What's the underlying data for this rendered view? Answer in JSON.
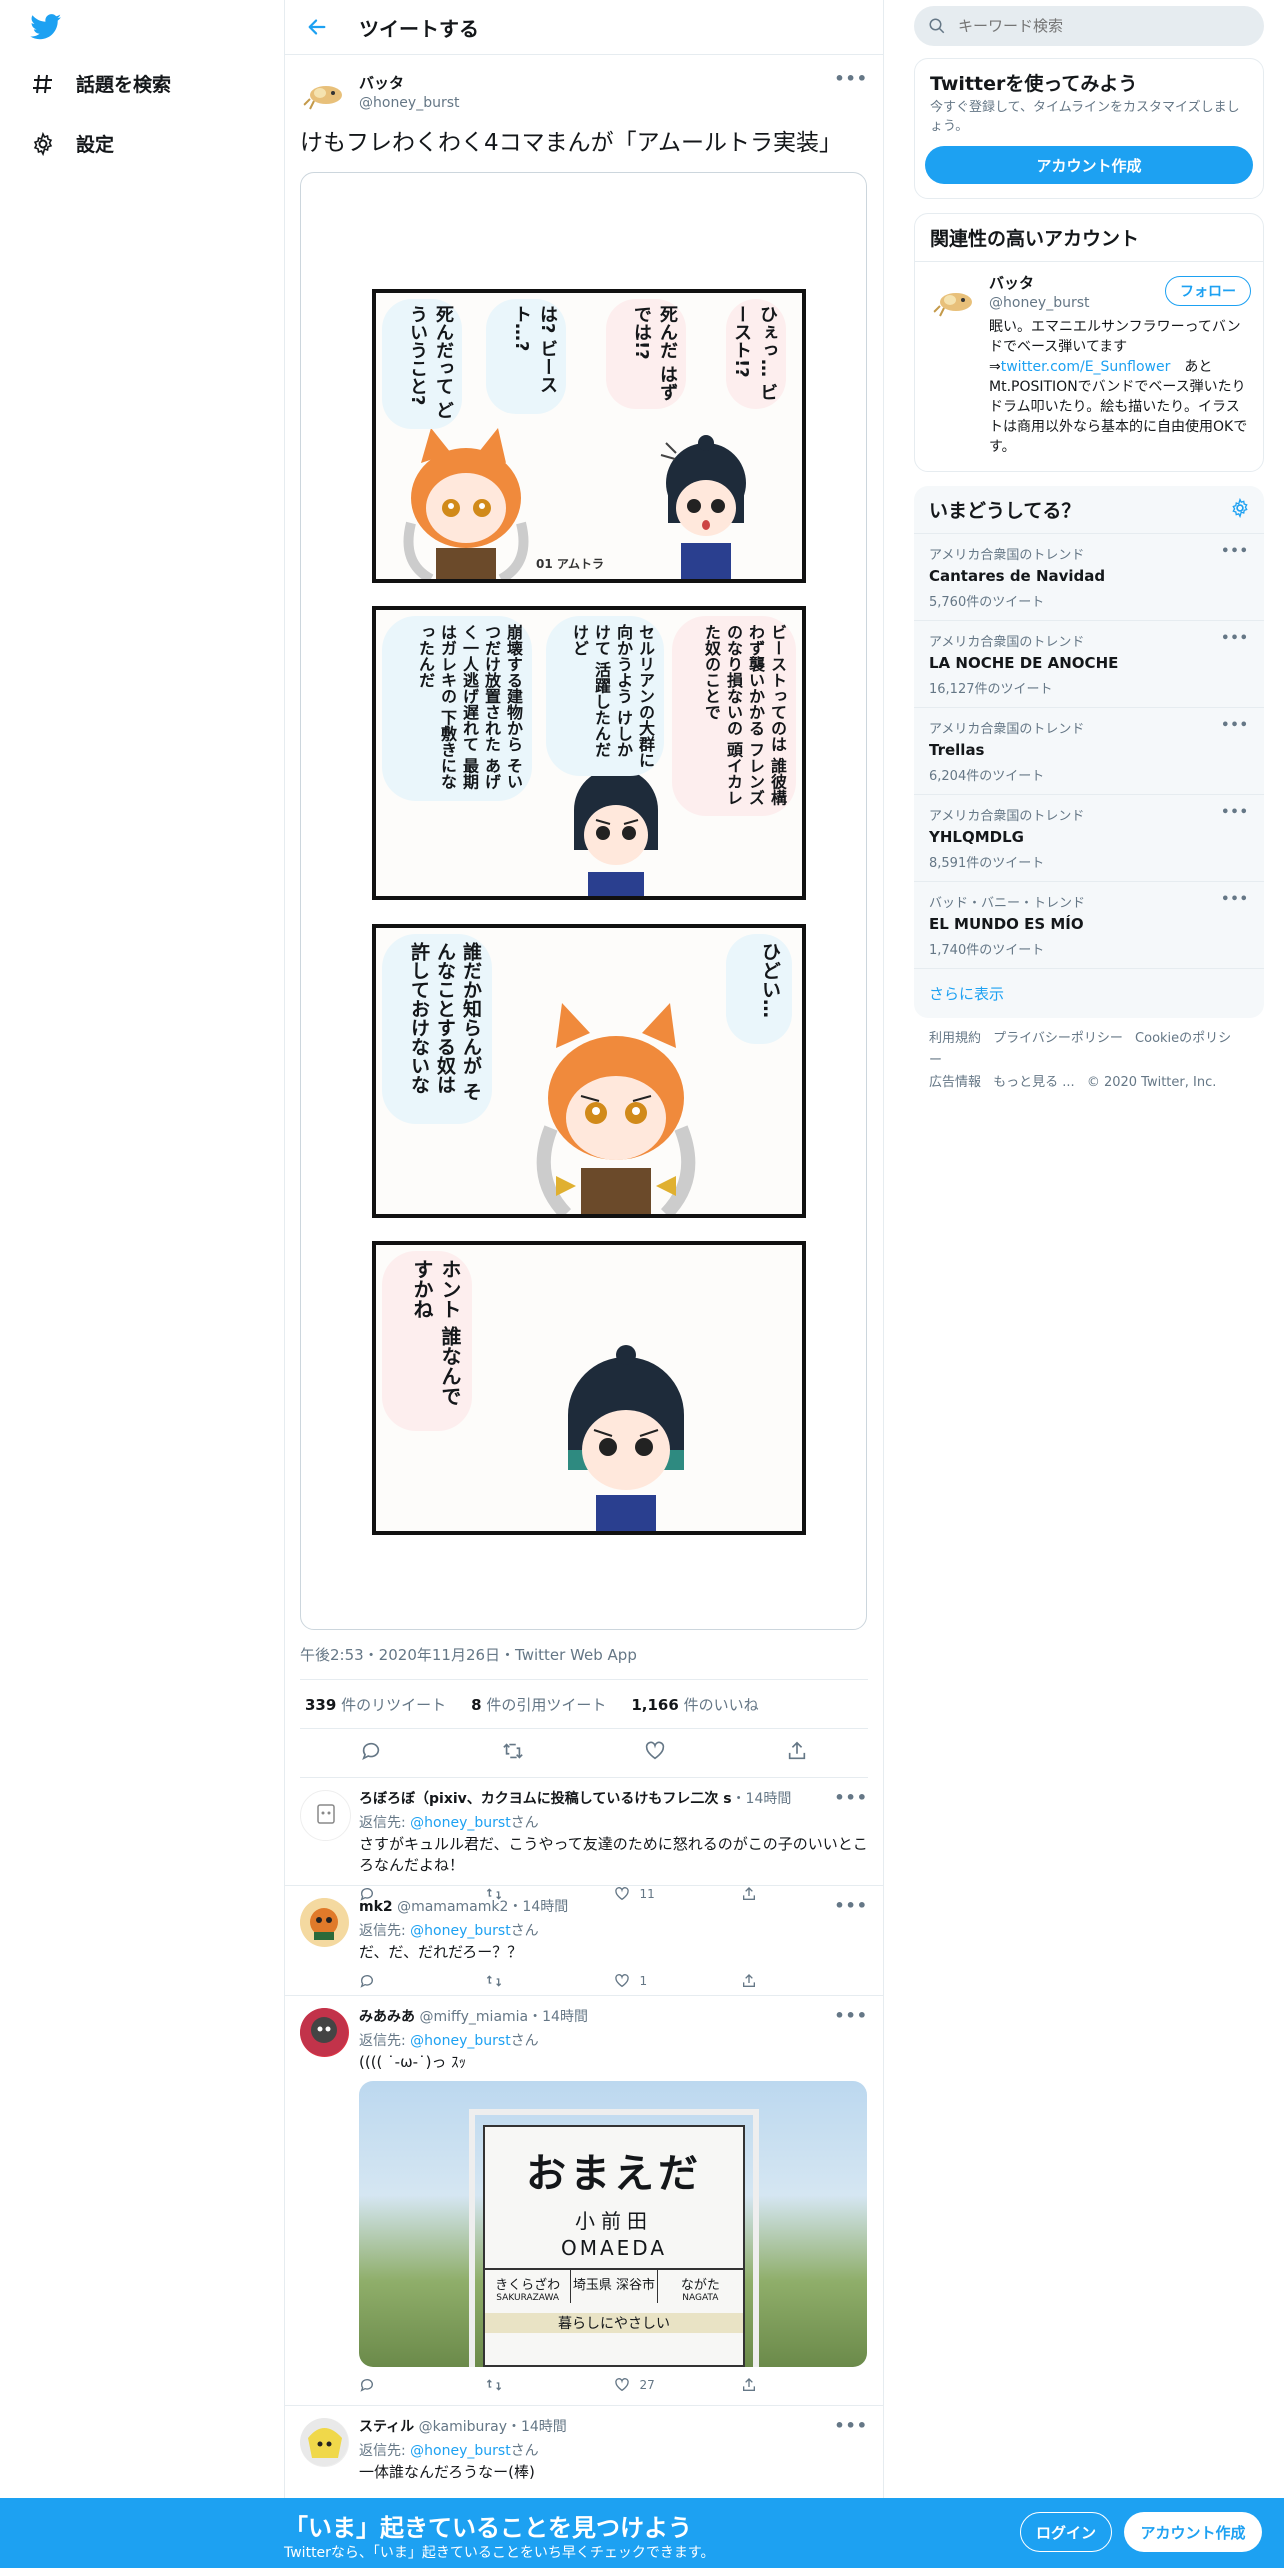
{
  "nav": {
    "explore": "話題を検索",
    "settings": "設定"
  },
  "header": {
    "title": "ツイートする"
  },
  "tweet": {
    "name": "バッタ",
    "handle": "@honey_burst",
    "text": "けもフレわくわく4コマまんが「アムールトラ実装」",
    "meta": "午後2:53・2020年11月26日・Twitter Web App",
    "retweets_num": "339",
    "retweets_label": "件のリツイート",
    "quotes_num": "8",
    "quotes_label": "件の引用ツイート",
    "likes_num": "1,166",
    "likes_label": "件のいいね",
    "more": "•••"
  },
  "comic": {
    "p1_b1": "ひぇっ… ビースト!?",
    "p1_b2": "死んだ はずでは!?",
    "p1_b3": "は? ビースト…?",
    "p1_b4": "死んだって どういうこと?",
    "p1_tag": "01 アムトラ",
    "p2_b1": "ビーストってのは 誰彼構わず襲いかかる フレンズのなり損ないの 頭イカレた奴のことで",
    "p2_b2": "セルリアンの大群に 向かうよう けしかけて 活躍したんだけど",
    "p2_b3": "崩壊する建物から そいつだけ放置された あげく一人逃げ遅れて 最期はガレキの 下敷きになったんだ",
    "p3_b1": "ひどい…",
    "p3_b2": "誰だか知らんが そんなことする奴は 許しておけないな",
    "p4_b1": "ホント 誰なんですかね"
  },
  "replies": [
    {
      "name": "ろぼろぼ（pixiv、カクヨムに投稿しているけもフレ二次 s",
      "handle": "",
      "time": "・14時間",
      "reply_prefix": "返信先: ",
      "reply_to": "@honey_burst",
      "reply_suffix": "さん",
      "text": "さすがキュルル君だ、こうやって友達のために怒れるのがこの子のいいところなんだよね！",
      "likes": "11"
    },
    {
      "name": "mk2",
      "handle": "@mamamamk2",
      "time": "・14時間",
      "reply_prefix": "返信先: ",
      "reply_to": "@honey_burst",
      "reply_suffix": "さん",
      "text": "だ、だ、だれだろー？？",
      "likes": "1"
    },
    {
      "name": "みあみあ",
      "handle": "@miffy_miamia",
      "time": "・14時間",
      "reply_prefix": "返信先: ",
      "reply_to": "@honey_burst",
      "reply_suffix": "さん",
      "text": "(((( ˙-ω-˙)っ ｽｯ",
      "likes": "27",
      "sign": {
        "big": "おまえだ",
        "kanji": "小前田",
        "romaji": "OMAEDA",
        "left_kana": "きくらざわ",
        "left_romaji": "SAKURAZAWA",
        "center": "埼玉県 深谷市",
        "right_kana": "ながた",
        "right_romaji": "NAGATA",
        "bottom": "暮らしにやさしい"
      }
    },
    {
      "name": "スティル",
      "handle": "@kamiburay",
      "time": "・14時間",
      "reply_prefix": "返信先: ",
      "reply_to": "@honey_burst",
      "reply_suffix": "さん",
      "text": "一体誰なんだろうなー(棒)"
    }
  ],
  "search": {
    "placeholder": "キーワード検索"
  },
  "signup_card": {
    "title": "Twitterを使ってみよう",
    "text": "今すぐ登録して、タイムラインをカスタマイズしましょう。",
    "button": "アカウント作成"
  },
  "related": {
    "title": "関連性の高いアカウント",
    "name": "バッタ",
    "handle": "@honey_burst",
    "follow": "フォロー",
    "bio_1": "眠い。エマニエルサンフラワーってバンドでベース弾いてます⇒",
    "bio_link": "twitter.com/E_Sunflower",
    "bio_2": "　あとMt.POSITIONでバンドでベース弾いたりドラム叩いたり。絵も描いたり。イラストは商用以外なら基本的に自由使用OKです。"
  },
  "trends": {
    "title": "いまどうしてる？",
    "items": [
      {
        "category": "アメリカ合衆国のトレンド",
        "name": "Cantares de Navidad",
        "count": "5,760件のツイート"
      },
      {
        "category": "アメリカ合衆国のトレンド",
        "name": "LA NOCHE DE ANOCHE",
        "count": "16,127件のツイート"
      },
      {
        "category": "アメリカ合衆国のトレンド",
        "name": "Trellas",
        "count": "6,204件のツイート"
      },
      {
        "category": "アメリカ合衆国のトレンド",
        "name": "YHLQMDLG",
        "count": "8,591件のツイート"
      },
      {
        "category": "バッド・バニー・トレンド",
        "name": "EL MUNDO ES MÍO",
        "count": "1,740件のツイート"
      }
    ],
    "more": "さらに表示"
  },
  "footer": {
    "terms": "利用規約",
    "privacy": "プライバシーポリシー",
    "cookie": "Cookieのポリシー",
    "ads": "広告情報",
    "more": "もっと見る ...",
    "copyright": "© 2020 Twitter, Inc."
  },
  "bottombar": {
    "title": "「いま」起きていることを見つけよう",
    "subtitle": "Twitterなら、「いま」起きていることをいち早くチェックできます。",
    "login": "ログイン",
    "signup": "アカウント作成"
  },
  "colors": {
    "accent": "#1da1f2",
    "border": "#e6ecf0",
    "secondary": "#657786"
  }
}
